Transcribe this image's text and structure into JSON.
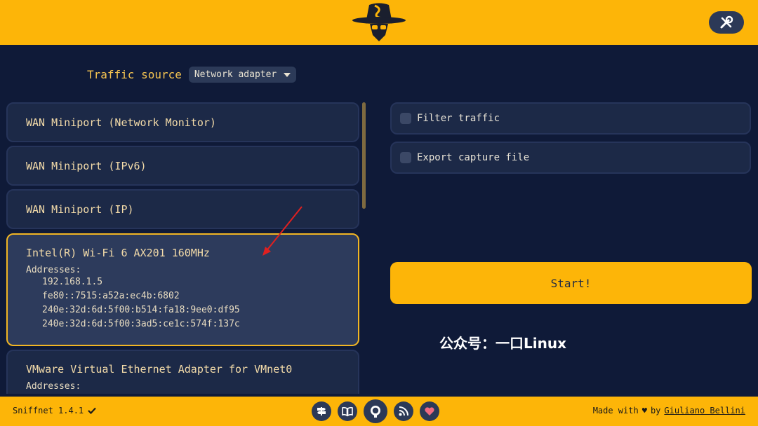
{
  "header": {
    "logo_icon": "sniffnet-logo-icon",
    "settings_icon": "wrench-icon"
  },
  "source": {
    "label": "Traffic source",
    "selected": "Network adapter"
  },
  "adapters": [
    {
      "name": "WAN Miniport (Network Monitor)"
    },
    {
      "name": "WAN Miniport (IPv6)"
    },
    {
      "name": "WAN Miniport (IP)"
    },
    {
      "name": "Intel(R) Wi-Fi 6 AX201 160MHz",
      "addresses_label": "Addresses:",
      "addresses": [
        "192.168.1.5",
        "fe80::7515:a52a:ec4b:6802",
        "240e:32d:6d:5f00:b514:fa18:9ee0:df95",
        "240e:32d:6d:5f00:3ad5:ce1c:574f:137c"
      ]
    },
    {
      "name": "VMware Virtual Ethernet Adapter for VMnet0",
      "addresses_label": "Addresses:"
    }
  ],
  "options": {
    "filter_label": "Filter traffic",
    "export_label": "Export capture file"
  },
  "start_label": "Start!",
  "watermark": "公众号：一口Linux",
  "footer": {
    "version": "Sniffnet 1.4.1",
    "made_with": "Made with",
    "heart": "♥",
    "by": "by",
    "author": "Giuliano Bellini",
    "icons": [
      "roadmap-icon",
      "book-icon",
      "github-icon",
      "rss-icon",
      "heart-icon"
    ]
  },
  "colors": {
    "accent": "#fdb508",
    "background": "#0f1a38",
    "card": "#1c2947",
    "selected_border": "#f2b623",
    "annotation_arrow": "#e02020"
  }
}
